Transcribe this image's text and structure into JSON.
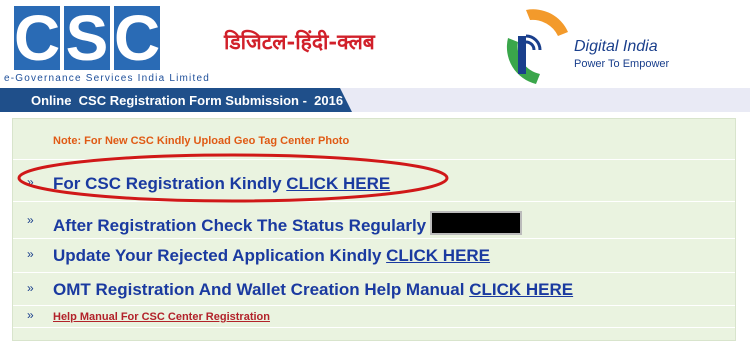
{
  "header": {
    "logo_letters": [
      "C",
      "S",
      "C"
    ],
    "tagline": "e-Governance Services India Limited",
    "hindi_club": "डिजिटल-हिंदी-क्लब",
    "digital_india_title": "Digital India",
    "digital_india_sub": "Power To Empower"
  },
  "titlebar": {
    "text": "Online  CSC Registration Form Submission -  2016"
  },
  "items": [
    {
      "bullet": "",
      "text": "Note: For New CSC Kindly Upload Geo Tag Center Photo",
      "link": ""
    },
    {
      "bullet": "»",
      "text": "For CSC Registration Kindly ",
      "link": "CLICK HERE"
    },
    {
      "bullet": "»",
      "text": "After Registration Check The Status Regularly",
      "link": ""
    },
    {
      "bullet": "»",
      "text": "Update Your Rejected Application Kindly ",
      "link": "CLICK HERE"
    },
    {
      "bullet": "»",
      "text": "OMT Registration And Wallet Creation Help Manual ",
      "link": "CLICK HERE"
    },
    {
      "bullet": "»",
      "text": "Help Manual For CSC Center Registration",
      "link": ""
    }
  ],
  "colors": {
    "brand_blue": "#2a6bb5",
    "title_bar": "#1f4f8a",
    "link_blue": "#1a3aa0",
    "note_orange": "#e05a14",
    "annotation_red": "#d01818",
    "panel_green": "#eaf3e0"
  }
}
